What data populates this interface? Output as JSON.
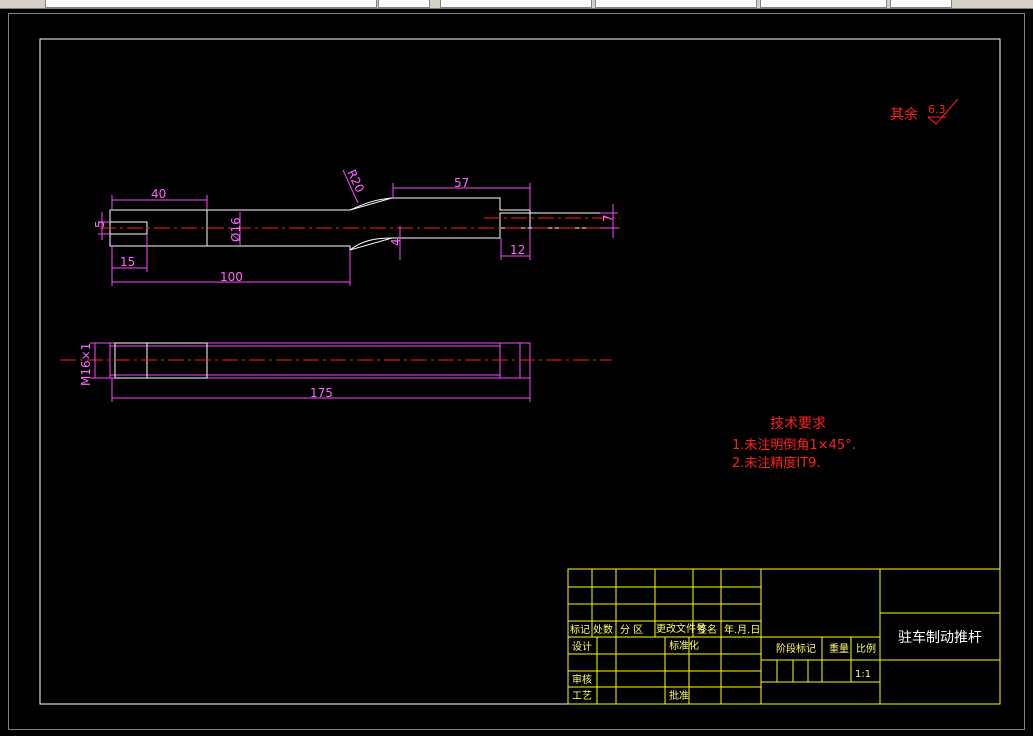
{
  "app": {
    "toolbar_note": ""
  },
  "drawing": {
    "surface_finish": {
      "label": "其余",
      "value": "6.3"
    },
    "tech_req": {
      "title": "技术要求",
      "line1": "1.未注明倒角1×45°.",
      "line2": "2.未注精度IT9."
    },
    "dims": {
      "d40": "40",
      "d57": "57",
      "r20": "R20",
      "d5": "5",
      "d16": "Ø16",
      "d4": "4",
      "d7": "7",
      "d15": "15",
      "d100": "100",
      "d12": "12",
      "m16": "M16×1",
      "d175": "175"
    },
    "title_block": {
      "part_name": "驻车制动推杆",
      "col_biaoji": "标记",
      "col_chushu": "处数",
      "col_fenqu": "分  区",
      "col_wenjian": "更改文件号",
      "col_qianming": "签名",
      "col_date": "年.月.日",
      "row_sheji": "设计",
      "row_biaozhun": "标准化",
      "row_shenhe": "审核",
      "row_gongyi": "工艺",
      "row_pizhun": "批准",
      "jieduan": "阶段标记",
      "zhongliang": "重量",
      "bili": "比例",
      "scale": "1:1"
    }
  },
  "colors": {
    "border": "#ffffff",
    "table_lines": "#ffff00",
    "dimension": "#ff44ff",
    "centerline": "#ff2020",
    "outline": "#ffffff"
  }
}
